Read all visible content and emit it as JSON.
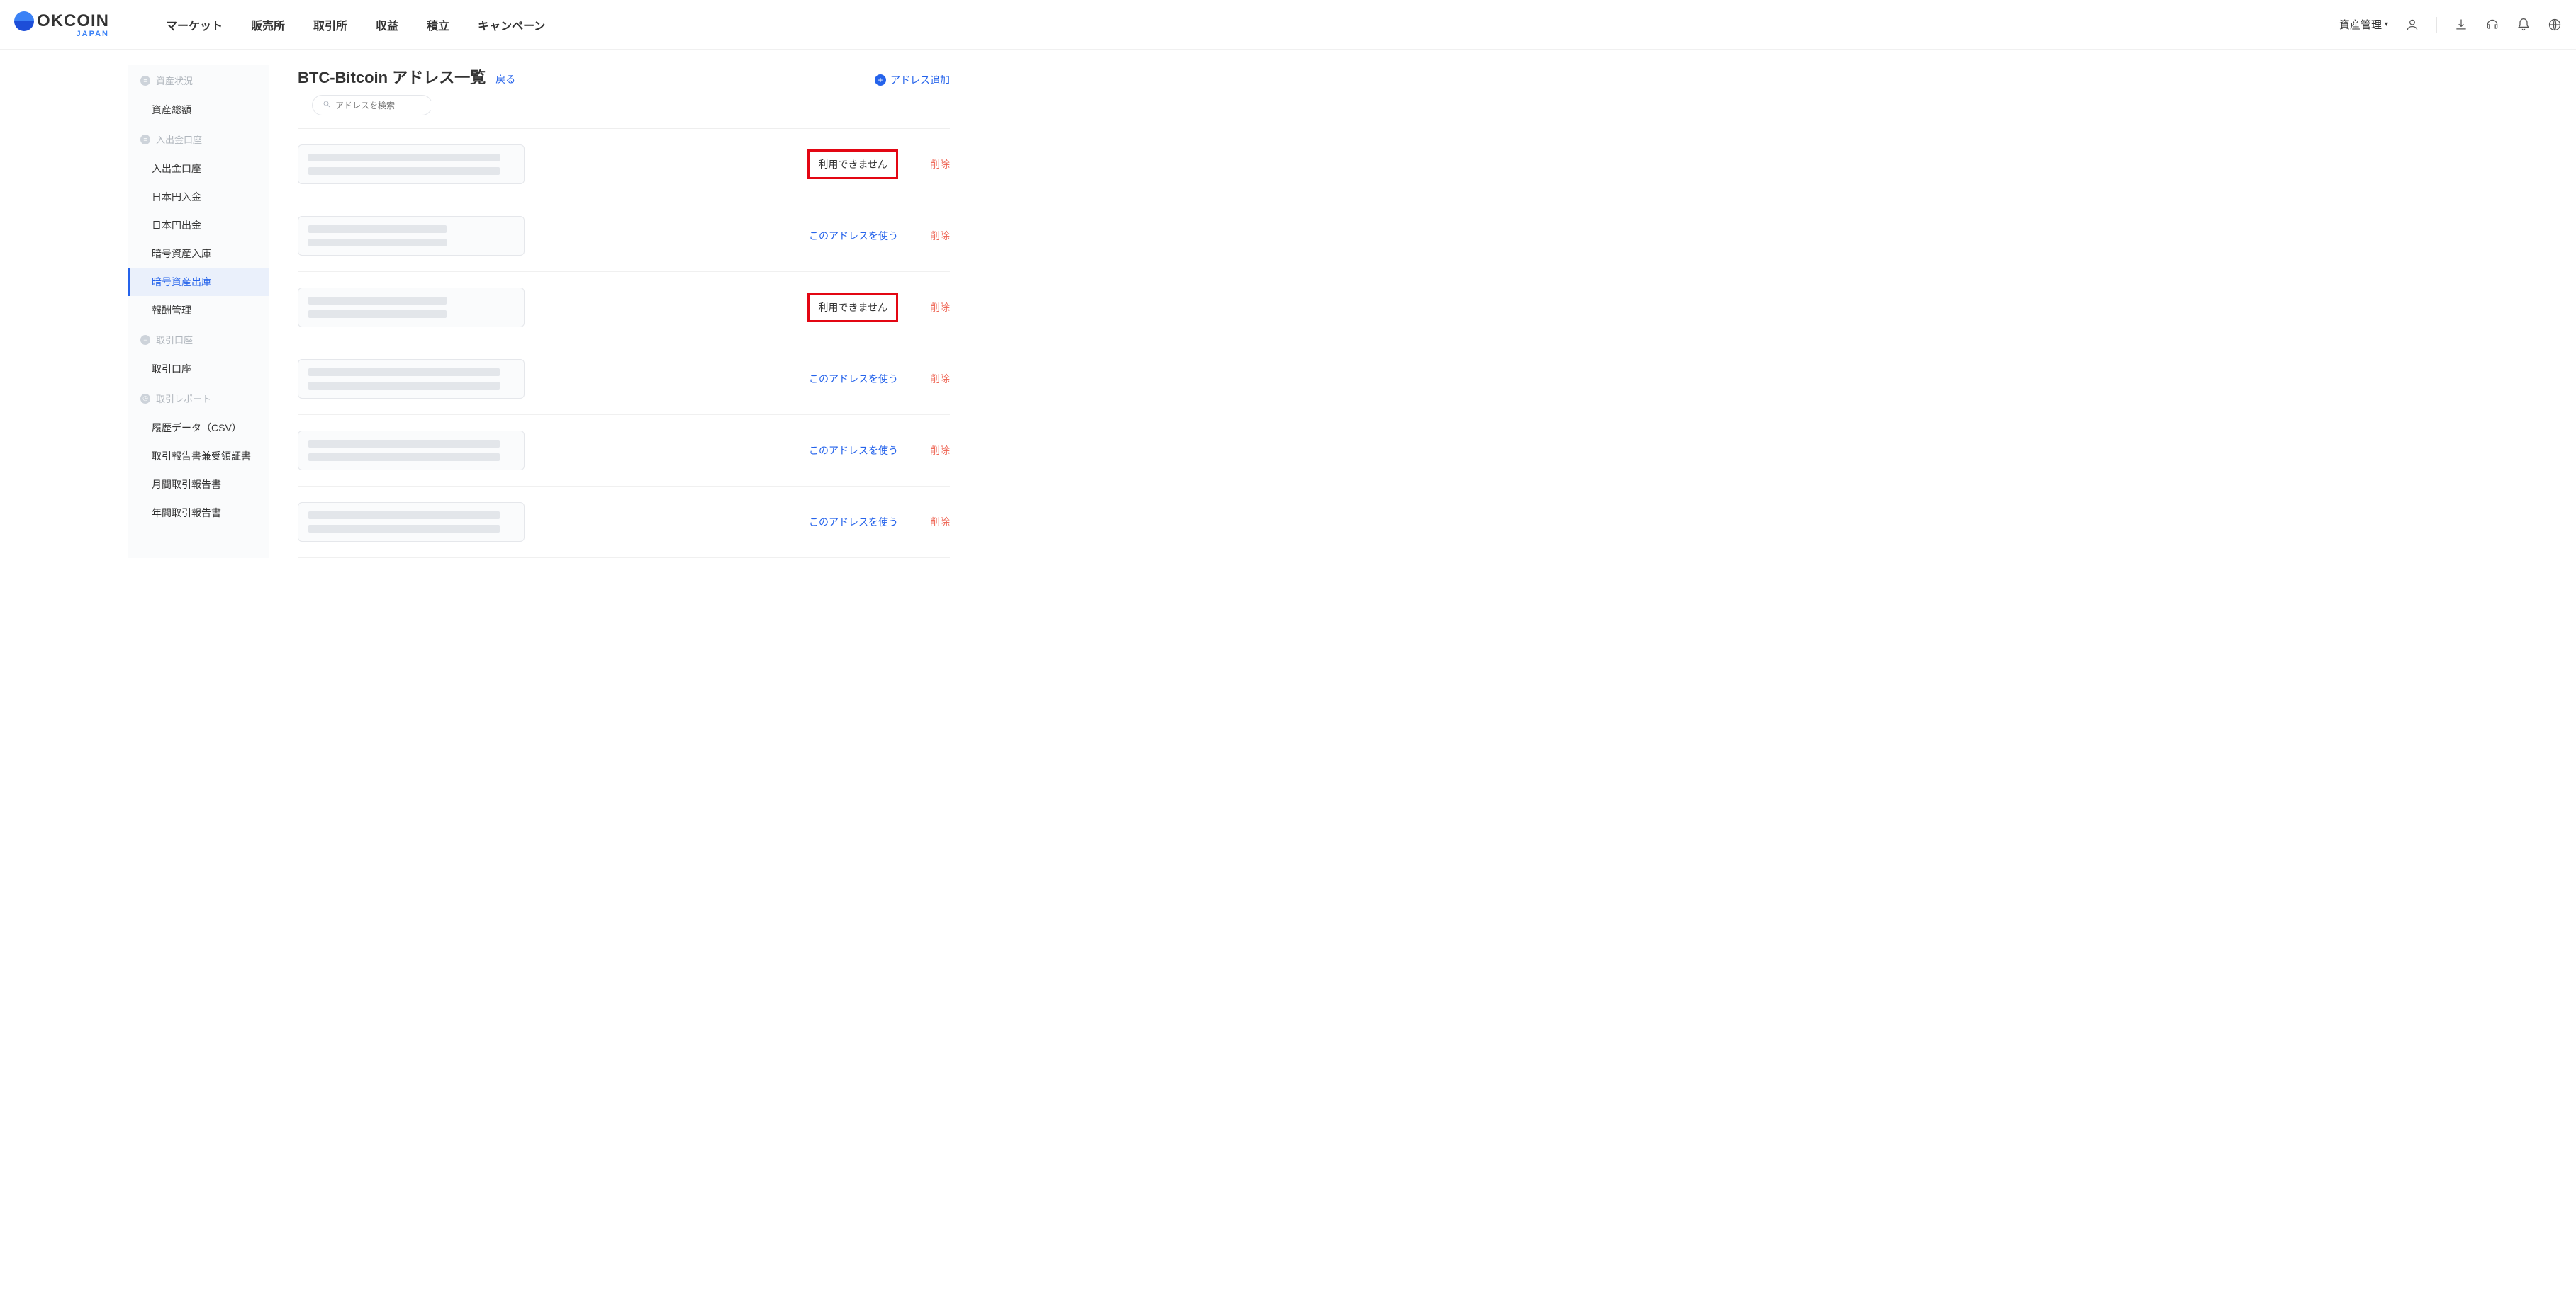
{
  "logo": {
    "main": "OKCOIN",
    "sub": "JAPAN"
  },
  "nav": {
    "links": [
      "マーケット",
      "販売所",
      "取引所",
      "収益",
      "積立",
      "キャンペーン"
    ],
    "asset_mgmt": "資産管理"
  },
  "sidebar": {
    "sections": [
      {
        "label": "資産状況",
        "items": [
          "資産総額"
        ]
      },
      {
        "label": "入出金口座",
        "items": [
          "入出金口座",
          "日本円入金",
          "日本円出金",
          "暗号資産入庫",
          "暗号資産出庫",
          "報酬管理"
        ],
        "active_index": 4
      },
      {
        "label": "取引口座",
        "items": [
          "取引口座"
        ]
      },
      {
        "label": "取引レポート",
        "items": [
          "履歴データ（CSV）",
          "取引報告書兼受領証書",
          "月間取引報告書",
          "年間取引報告書"
        ]
      }
    ]
  },
  "page": {
    "title": "BTC-Bitcoin アドレス一覧",
    "back": "戻る",
    "add_address": "アドレス追加",
    "search_placeholder": "アドレスを検索"
  },
  "row_labels": {
    "use": "このアドレスを使う",
    "unavailable": "利用できません",
    "delete": "削除"
  },
  "rows": [
    {
      "status": "unavailable",
      "highlighted": true,
      "sk": [
        "w1",
        "w1"
      ]
    },
    {
      "status": "use",
      "highlighted": false,
      "sk": [
        "w2",
        "w2"
      ]
    },
    {
      "status": "unavailable",
      "highlighted": true,
      "sk": [
        "w2",
        "w2"
      ]
    },
    {
      "status": "use",
      "highlighted": false,
      "sk": [
        "w1",
        "w1"
      ]
    },
    {
      "status": "use",
      "highlighted": false,
      "sk": [
        "w1",
        "w1"
      ]
    },
    {
      "status": "use",
      "highlighted": false,
      "sk": [
        "w1",
        "w1"
      ]
    }
  ]
}
